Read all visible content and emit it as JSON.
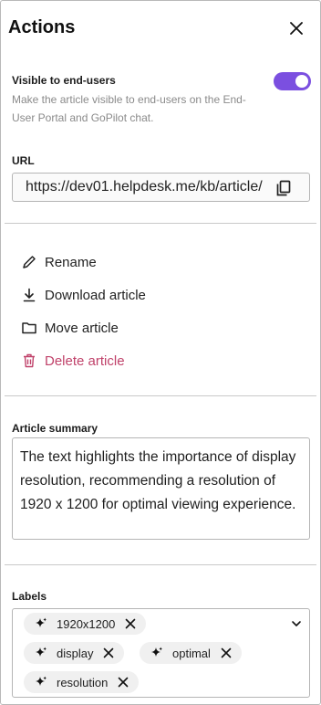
{
  "header": {
    "title": "Actions",
    "close_icon": "close-icon"
  },
  "visibility": {
    "title": "Visible to end-users",
    "description": "Make the article visible to end-users on the End-User Portal and GoPilot chat.",
    "enabled": true,
    "toggle_color": "#7b4fe0"
  },
  "url": {
    "label": "URL",
    "value": "https://dev01.helpdesk.me/kb/article/",
    "copy_icon": "copy-icon"
  },
  "actions": [
    {
      "label": "Rename",
      "icon": "pencil-icon"
    },
    {
      "label": "Download article",
      "icon": "download-icon"
    },
    {
      "label": "Move article",
      "icon": "folder-icon"
    },
    {
      "label": "Delete article",
      "icon": "trash-icon",
      "color": "#c0426a"
    }
  ],
  "summary": {
    "label": "Article summary",
    "text": "The text highlights the importance of display resolution, recommending a resolution of 1920 x 1200 for optimal viewing experience."
  },
  "labels": {
    "label": "Labels",
    "items": [
      "1920x1200",
      "display",
      "optimal",
      "resolution"
    ],
    "chip_icon": "sparkle-icon",
    "remove_icon": "close-icon",
    "expand_icon": "chevron-down-icon"
  }
}
